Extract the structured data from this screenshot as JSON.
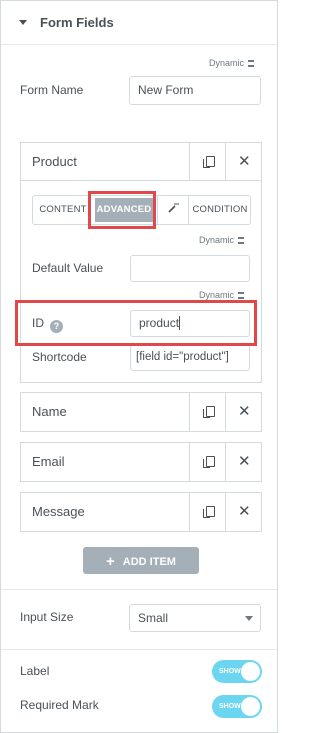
{
  "section": {
    "title": "Form Fields"
  },
  "dynamic_label": "Dynamic",
  "form_name": {
    "label": "Form Name",
    "value": "New Form"
  },
  "fields": [
    {
      "title": "Product"
    },
    {
      "title": "Name"
    },
    {
      "title": "Email"
    },
    {
      "title": "Message"
    }
  ],
  "tabs": {
    "content": "CONTENT",
    "advanced": "ADVANCED",
    "condition": "CONDITION"
  },
  "default_value": {
    "label": "Default Value",
    "value": ""
  },
  "id_field": {
    "label": "ID",
    "help": "?",
    "value": "product"
  },
  "shortcode": {
    "label": "Shortcode",
    "value": "[field id=\"product\"]"
  },
  "add_item": {
    "label": "ADD ITEM",
    "icon": "plus-icon"
  },
  "input_size": {
    "label": "Input Size",
    "value": "Small"
  },
  "label_toggle": {
    "label": "Label",
    "state": "SHOW"
  },
  "required_toggle": {
    "label": "Required Mark",
    "state": "SHOW"
  },
  "colors": {
    "accent_switch": "#6cd6f0",
    "highlight": "#e0484b",
    "active_tab": "#a4afb7"
  }
}
